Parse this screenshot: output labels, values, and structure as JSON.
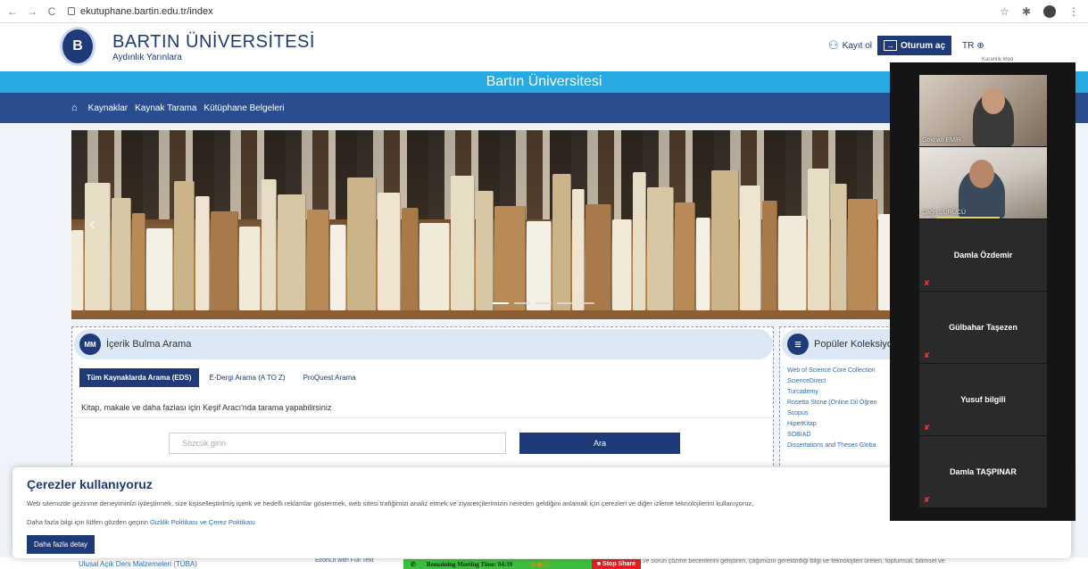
{
  "browser": {
    "url": "ekutuphane.bartin.edu.tr/index",
    "back_icon": "←",
    "forward_icon": "→",
    "reload_icon": "C",
    "star_icon": "☆",
    "extensions_icon": "✱",
    "menu_icon": "⋮"
  },
  "header": {
    "logo_text": "B",
    "title": "BARTIN ÜNİVERSİTESİ",
    "subtitle": "Aydınlık Yarınlara",
    "register_icon": "⚇",
    "register_label": "Kayıt ol",
    "login_icon": "→",
    "login_label": "Oturum aç",
    "lang_label": "TR",
    "lang_icon": "⊕",
    "dark_mode_label": "Karanlık Mod"
  },
  "title_band": "Bartın Üniversitesi",
  "menu": {
    "home_icon": "⌂",
    "items": [
      "Kaynaklar",
      "Kaynak Tarama",
      "Kütüphane Belgeleri"
    ]
  },
  "carousel": {
    "prev_icon": "‹",
    "slides": 5,
    "active_slide": 1
  },
  "search": {
    "panel_icon": "MM",
    "heading": "İçerik Bulma Arama",
    "tabs": [
      "Tüm Kaynaklarda Arama (EDS)",
      "E-Dergi Arama (A TO Z)",
      "ProQuest Arama"
    ],
    "description": "Kitap, makale ve daha fazlası için Keşif Aracı'nda tarama yapabilirsiniz",
    "placeholder": "Sözcük girin",
    "button": "Ara"
  },
  "collections": {
    "icon": "☰",
    "heading": "Popüler Koleksiyo",
    "items": [
      "Web of Science Core Collection",
      "ScienceDirect",
      "Turcademy",
      "Rosetta Stone (Online Dil Öğren",
      "Scopus",
      "HiperKitap",
      "SOBİAD",
      "Dissertations and Theses Globa"
    ]
  },
  "bottom": {
    "link1": "Ulusal Açık Ders Malzemeleri (TÜBA)",
    "link2": "EconLit with Full Text",
    "text3": "ve sorun çözme becerilerini geliştiren, çağımızın gerektirdiği bilgi ve teknolojileri üreten, toplumsal, bilimsel ve"
  },
  "meeting": {
    "phone_icon": "✆",
    "remaining": "Remaining Meeting Time: 04:39",
    "mic_icon": "⊙ ⊛ ⓘ",
    "stop_label": "■ Stop Share"
  },
  "cookie": {
    "title": "Çerezler kullanıyoruz",
    "text": "Web sitemizde gezinme deneyiminizi iyileştirmek, size kişiselleştirilmiş içerik ve hedefli reklamlar göstermek, web sitesi trafiğimizi analiz etmek ve ziyaretçilerimizin nereden geldiğini anlamak için çerezleri ve diğer izleme teknolojilerini kullanıyoruz,",
    "more_prefix": "Daha fazla bilgi için lütfen gözden geçirin ",
    "policy_link": "Gizlilik Politikası ve Çerez Politikası",
    "button": "Daha fazla detay"
  },
  "participants": [
    {
      "name": "Gökhan EMİR",
      "video": true
    },
    {
      "name": "Çağrı SÜRÜCÜ",
      "video": true
    },
    {
      "name": "Damla Özdemir",
      "video": false
    },
    {
      "name": "Gülbahar Taşezen",
      "video": false
    },
    {
      "name": "Yusuf bilgili",
      "video": false
    },
    {
      "name": "Damla TAŞPINAR",
      "video": false
    }
  ],
  "mic_off_icon": "✘",
  "colors": {
    "primary": "#1e3a78",
    "accent": "#27a9e1",
    "menu": "#2a4d8f",
    "meeting": "#3dbf3d",
    "stop": "#e02020"
  }
}
